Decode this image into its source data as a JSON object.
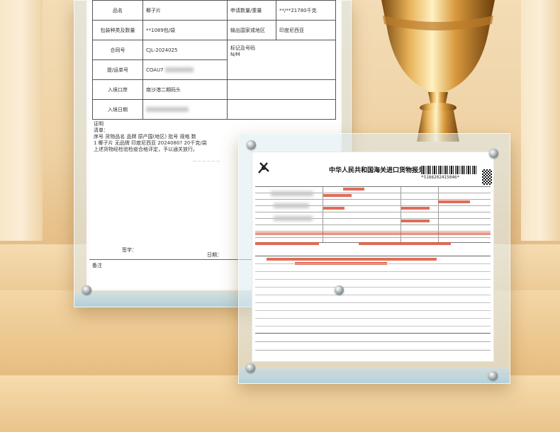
{
  "back_document": {
    "rows": [
      {
        "label": "品名",
        "value": "椰子片",
        "label2": "申请数量/重量",
        "value2": "**/**21780千克"
      },
      {
        "label": "包装种类及数量",
        "value": "**1089包/袋",
        "label2": "输出国家或地区",
        "value2": "印度尼西亚"
      },
      {
        "label": "合同号",
        "value": "CJL-2024025",
        "label2": "标记及号码",
        "value2": "N/M"
      },
      {
        "label": "提/运单号",
        "value": "COAU7"
      },
      {
        "label": "入境口岸",
        "value": "南沙港二期码头"
      },
      {
        "label": "入境日期",
        "value": ""
      }
    ],
    "prove_lines": [
      "证明",
      "清单：",
      "序号  货物品名  品牌   原产国(地区)  批号        规格        数",
      "1     椰子片    无品牌  印度尼西亚     2024080?   20千克/袋",
      "上述货物经检验检疫合格评定，予以通关放行。"
    ],
    "sign_label": "签字：",
    "date_label": "日期：",
    "remark_label": "备注"
  },
  "front_document": {
    "title": "中华人民共和国海关进口货物报关单",
    "barcode_number": "*5166202415046*"
  }
}
